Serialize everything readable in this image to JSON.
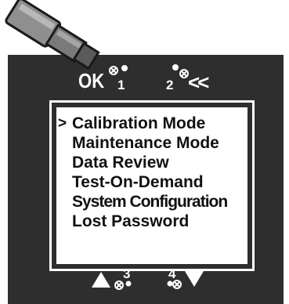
{
  "device": {
    "buttons": {
      "ok": {
        "label": "OK",
        "number": "1",
        "icon": "magnet-sensor-icon"
      },
      "back": {
        "label": "<<",
        "number": "2",
        "icon": "magnet-sensor-icon"
      },
      "up": {
        "icon": "up-triangle-icon",
        "number": "3"
      },
      "down": {
        "icon": "down-triangle-icon",
        "number": "4"
      }
    },
    "cursor": ">",
    "menu": [
      {
        "label": "Calibration Mode",
        "selected": true
      },
      {
        "label": "Maintenance Mode",
        "selected": false
      },
      {
        "label": "Data Review",
        "selected": false
      },
      {
        "label": "Test-On-Demand",
        "selected": false
      },
      {
        "label": "System Configuration",
        "selected": false
      },
      {
        "label": "Lost Password",
        "selected": false
      }
    ]
  },
  "colors": {
    "panel": "#2e2e2e",
    "screen": "#ffffff",
    "text": "#111111",
    "wand": "#8a8a8a"
  }
}
